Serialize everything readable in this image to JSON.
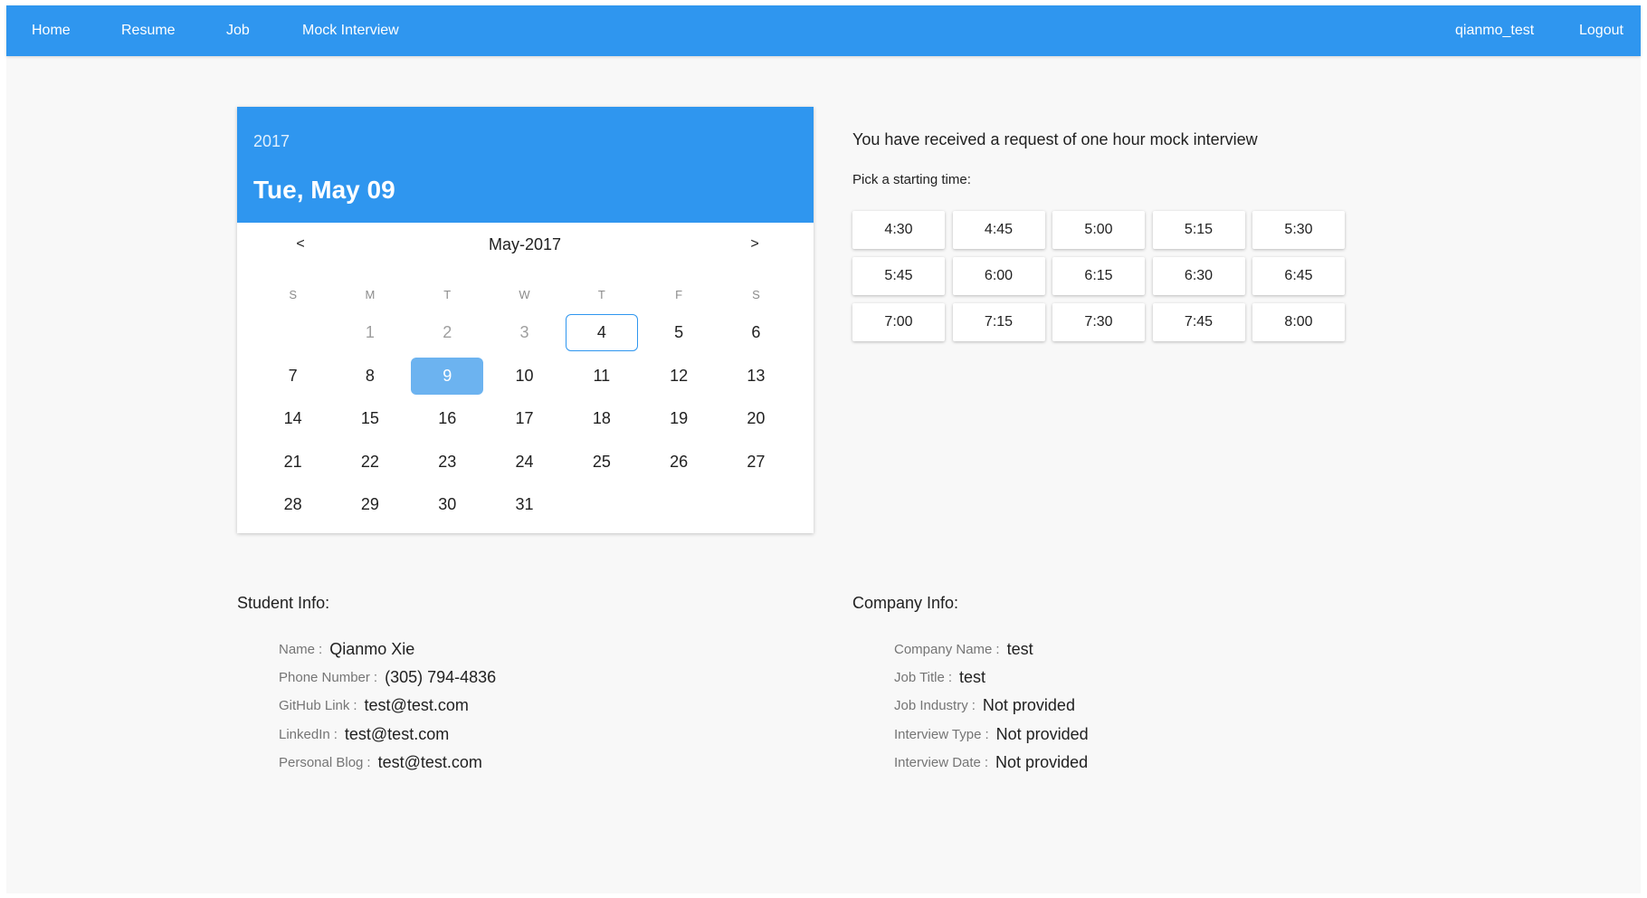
{
  "nav": {
    "left": [
      "Home",
      "Resume",
      "Job",
      "Mock Interview"
    ],
    "username": "qianmo_test",
    "logout": "Logout"
  },
  "calendar": {
    "year": "2017",
    "selected_date_label": "Tue, May 09",
    "month_label": "May-2017",
    "prev": "<",
    "next": ">",
    "weekdays": [
      "S",
      "M",
      "T",
      "W",
      "T",
      "F",
      "S"
    ],
    "first_weekday_index": 1,
    "days_in_month": 31,
    "disabled_days": [
      1,
      2,
      3
    ],
    "today": 4,
    "selected": 9
  },
  "request": {
    "title": "You have received a request of one hour mock interview",
    "pick_label": "Pick a starting time:",
    "times": [
      "4:30",
      "4:45",
      "5:00",
      "5:15",
      "5:30",
      "5:45",
      "6:00",
      "6:15",
      "6:30",
      "6:45",
      "7:00",
      "7:15",
      "7:30",
      "7:45",
      "8:00"
    ]
  },
  "student": {
    "title": "Student Info:",
    "fields": [
      {
        "label": "Name",
        "value": "Qianmo Xie"
      },
      {
        "label": "Phone Number",
        "value": "(305) 794-4836"
      },
      {
        "label": "GitHub Link",
        "value": "test@test.com"
      },
      {
        "label": "LinkedIn",
        "value": "test@test.com"
      },
      {
        "label": "Personal Blog",
        "value": "test@test.com"
      }
    ]
  },
  "company": {
    "title": "Company Info:",
    "fields": [
      {
        "label": "Company Name",
        "value": "test"
      },
      {
        "label": "Job Title",
        "value": "test"
      },
      {
        "label": "Job Industry",
        "value": "Not provided"
      },
      {
        "label": "Interview Type",
        "value": "Not provided"
      },
      {
        "label": "Interview Date",
        "value": "Not provided"
      }
    ]
  },
  "colors": {
    "primary": "#2f96ef",
    "selected_day": "#6cb3f0",
    "background": "#f8f8f8"
  }
}
